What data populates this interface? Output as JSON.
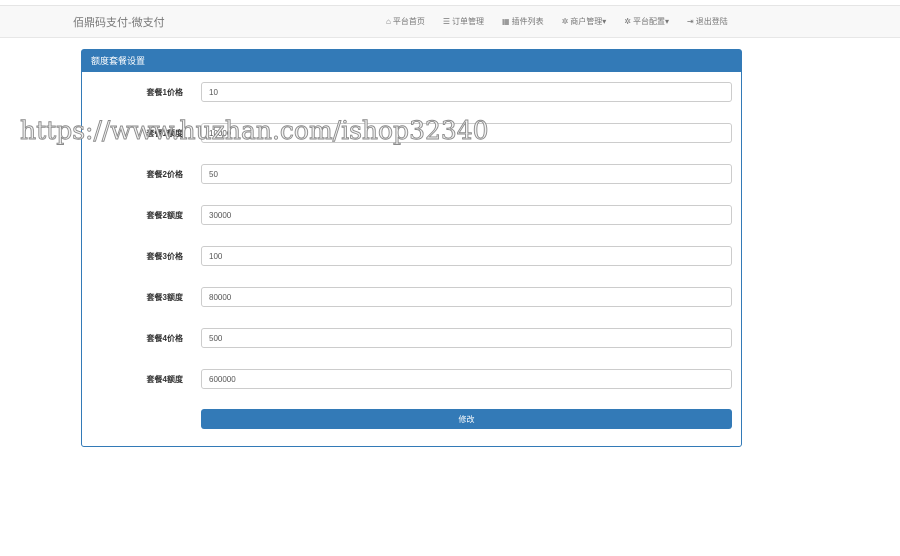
{
  "brand": "佰鼎码支付-微支付",
  "nav": [
    {
      "icon": "home-icon",
      "glyph": "⌂",
      "label": "平台首页"
    },
    {
      "icon": "list-icon",
      "glyph": "☰",
      "label": "订单管理"
    },
    {
      "icon": "grid-icon",
      "glyph": "▦",
      "label": "插件列表"
    },
    {
      "icon": "gear-icon",
      "glyph": "✲",
      "label": "商户管理▾"
    },
    {
      "icon": "gear-icon",
      "glyph": "✲",
      "label": "平台配置▾"
    },
    {
      "icon": "logout-icon",
      "glyph": "⇥",
      "label": "退出登陆"
    }
  ],
  "panel": {
    "title": "额度套餐设置",
    "submit": "修改",
    "fields": [
      {
        "label": "套餐1价格",
        "value": "10"
      },
      {
        "label": "套餐1额度",
        "value": "10000"
      },
      {
        "label": "套餐2价格",
        "value": "50"
      },
      {
        "label": "套餐2额度",
        "value": "30000"
      },
      {
        "label": "套餐3价格",
        "value": "100"
      },
      {
        "label": "套餐3额度",
        "value": "80000"
      },
      {
        "label": "套餐4价格",
        "value": "500"
      },
      {
        "label": "套餐4额度",
        "value": "600000"
      }
    ]
  },
  "watermark": "https://www.huzhan.com/ishop32340"
}
